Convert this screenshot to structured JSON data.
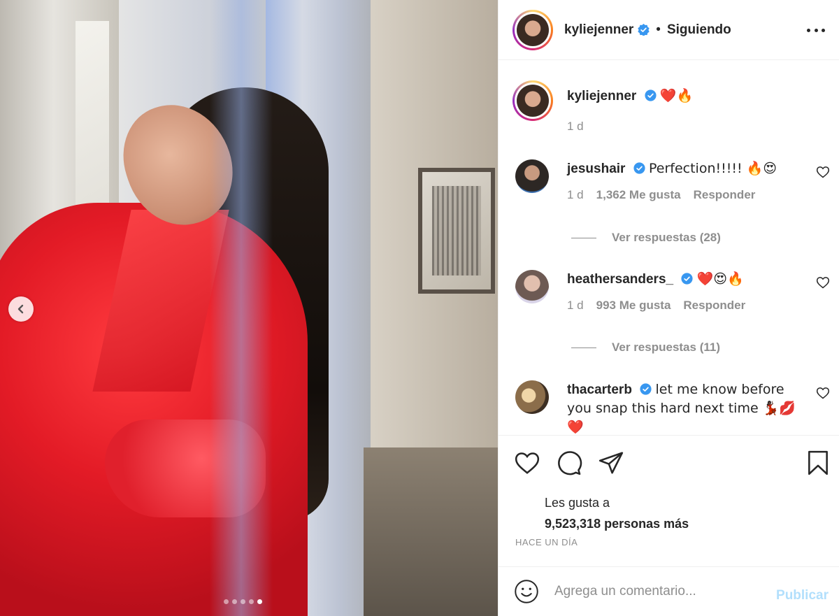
{
  "post": {
    "author": "kyliejenner",
    "follow_state": "Siguiendo",
    "separator": "•",
    "caption_emojis": "❤️🔥",
    "caption_time": "1 d",
    "carousel_total": 5,
    "carousel_active": 5
  },
  "comments": [
    {
      "user": "jesushair",
      "verified": true,
      "text": "Perfection!!!!! 🔥😍",
      "time": "1 d",
      "likes": "1,362 Me gusta",
      "reply": "Responder",
      "view_replies": "Ver respuestas (28)"
    },
    {
      "user": "heathersanders_",
      "verified": true,
      "text": "❤️😍🔥",
      "time": "1 d",
      "likes": "993 Me gusta",
      "reply": "Responder",
      "view_replies": "Ver respuestas (11)"
    },
    {
      "user": "thacarterb",
      "verified": true,
      "text": "let me know before you snap this hard next time 💃🏿💋",
      "text_line2": "❤️"
    }
  ],
  "likes_section": {
    "line1": "Les gusta a",
    "line2": "9,523,318 personas más"
  },
  "timestamp": "HACE UN DÍA",
  "composer": {
    "placeholder": "Agrega un comentario...",
    "publish": "Publicar"
  },
  "icons": {
    "nav_prev": "chevron-left-icon",
    "more": "more-horizontal-icon",
    "verified": "verified-badge-icon",
    "like": "heart-icon",
    "comment": "comment-bubble-icon",
    "share": "paper-plane-icon",
    "save": "bookmark-icon",
    "emoji": "smiley-icon"
  },
  "colors": {
    "verified_blue": "#3897f0",
    "muted": "#8e8e8e",
    "text": "#262626",
    "publish_disabled": "#b2dffc"
  }
}
